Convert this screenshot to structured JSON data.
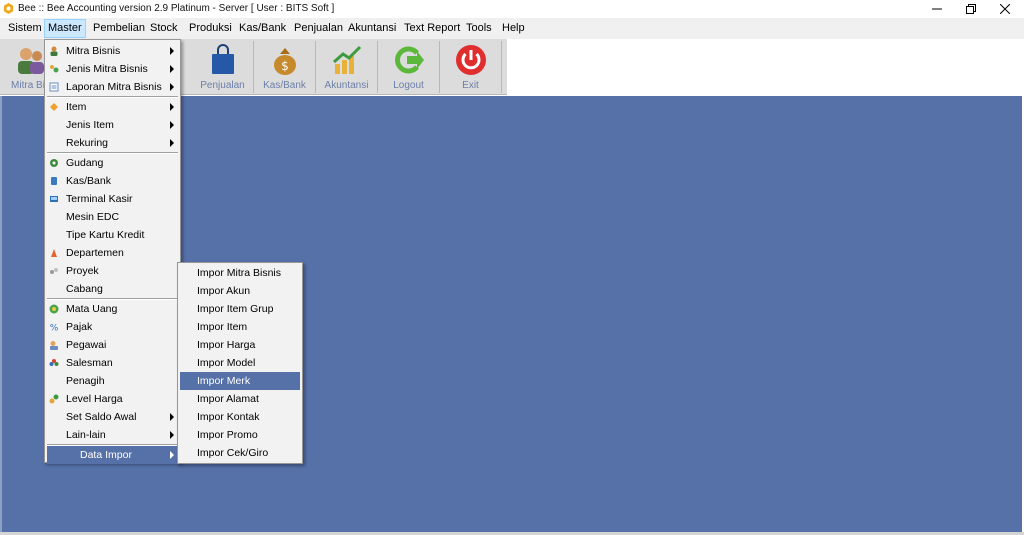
{
  "window": {
    "title": "Bee :: Bee Accounting version 2.9 Platinum - Server  [ User : BITS Soft ]",
    "icon": "bee-icon",
    "controls": [
      {
        "name": "minimize",
        "glyph": "—"
      },
      {
        "name": "restore",
        "glyph": "❐"
      },
      {
        "name": "close",
        "glyph": "✕"
      }
    ]
  },
  "menubar": {
    "items": [
      {
        "label": "Sistem",
        "active": false
      },
      {
        "label": "Master",
        "active": true
      },
      {
        "label": "Pembelian",
        "active": false
      },
      {
        "label": "Stock",
        "active": false
      },
      {
        "label": "Produksi",
        "active": false
      },
      {
        "label": "Kas/Bank",
        "active": false
      },
      {
        "label": "Penjualan",
        "active": false
      },
      {
        "label": "Akuntansi",
        "active": false
      },
      {
        "label": "Text Report",
        "active": false
      },
      {
        "label": "Tools",
        "active": false
      },
      {
        "label": "Help",
        "active": false
      }
    ]
  },
  "toolbar": {
    "items": [
      {
        "label": "Mitra Bis",
        "icon": "people-icon"
      },
      {
        "label": "Penjualan",
        "icon": "shopping-bag-icon"
      },
      {
        "label": "Kas/Bank",
        "icon": "money-bag-icon"
      },
      {
        "label": "Akuntansi",
        "icon": "chart-up-icon"
      },
      {
        "label": "Logout",
        "icon": "logout-arrow-icon"
      },
      {
        "label": "Exit",
        "icon": "power-icon"
      }
    ]
  },
  "master_menu": {
    "items": [
      {
        "label": "Mitra Bisnis",
        "icon": "person-icon",
        "submenu": true
      },
      {
        "label": "Jenis Mitra Bisnis",
        "icon": "group-icon",
        "submenu": true
      },
      {
        "label": "Laporan Mitra Bisnis",
        "icon": "report-icon",
        "submenu": true
      },
      {
        "label": "Item",
        "icon": "item-icon",
        "submenu": true
      },
      {
        "label": "Jenis Item",
        "icon": "",
        "submenu": true
      },
      {
        "label": "Rekuring",
        "icon": "",
        "submenu": true
      },
      {
        "label": "Gudang",
        "icon": "warehouse-icon",
        "submenu": false
      },
      {
        "label": "Kas/Bank",
        "icon": "cash-icon",
        "submenu": false
      },
      {
        "label": "Terminal Kasir",
        "icon": "cashier-icon",
        "submenu": false
      },
      {
        "label": "Mesin EDC",
        "icon": "",
        "submenu": false
      },
      {
        "label": "Tipe Kartu Kredit",
        "icon": "",
        "submenu": false
      },
      {
        "label": "Departemen",
        "icon": "department-icon",
        "submenu": false
      },
      {
        "label": "Proyek",
        "icon": "project-icon",
        "submenu": false
      },
      {
        "label": "Cabang",
        "icon": "",
        "submenu": false
      },
      {
        "label": "Mata Uang",
        "icon": "currency-icon",
        "submenu": false
      },
      {
        "label": "Pajak",
        "icon": "tax-icon",
        "submenu": false
      },
      {
        "label": "Pegawai",
        "icon": "employee-icon",
        "submenu": false
      },
      {
        "label": "Salesman",
        "icon": "salesman-icon",
        "submenu": false
      },
      {
        "label": "Penagih",
        "icon": "",
        "submenu": false
      },
      {
        "label": "Level Harga",
        "icon": "price-level-icon",
        "submenu": false
      },
      {
        "label": "Set Saldo Awal",
        "icon": "",
        "submenu": true
      },
      {
        "label": "Lain-lain",
        "icon": "",
        "submenu": true
      },
      {
        "label": "Data Impor",
        "icon": "",
        "submenu": true,
        "highlighted": true
      }
    ]
  },
  "impor_menu": {
    "items": [
      {
        "label": "Impor Mitra Bisnis"
      },
      {
        "label": "Impor Akun"
      },
      {
        "label": "Impor Item Grup"
      },
      {
        "label": "Impor Item"
      },
      {
        "label": "Impor Harga"
      },
      {
        "label": "Impor Model"
      },
      {
        "label": "Impor Merk",
        "highlighted": true
      },
      {
        "label": "Impor Alamat"
      },
      {
        "label": "Impor Kontak"
      },
      {
        "label": "Impor Promo"
      },
      {
        "label": "Impor Cek/Giro"
      }
    ]
  },
  "colors": {
    "workspace": "#5670a8",
    "highlight": "#5670a8",
    "menu_bg": "#f2f2f2",
    "toolbar_bg": "#dcdcdc",
    "toolbar_label": "#6b7fa8"
  }
}
